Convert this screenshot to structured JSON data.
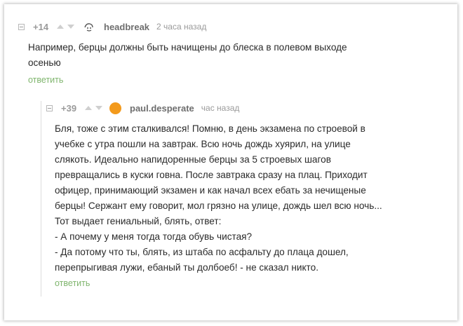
{
  "comments": [
    {
      "rating": "+14",
      "username": "headbreak",
      "time": "2 часа назад",
      "lines": [
        "Например, берцы должны быть начищены до блеска в полевом выходе",
        "осенью"
      ],
      "reply_label": "ответить"
    },
    {
      "rating": "+39",
      "username": "paul.desperate",
      "time": "час назад",
      "avatar_color": "#f39a1c",
      "lines": [
        "Бля, тоже с этим сталкивался! Помню, в день экзамена по строевой в",
        "учебке с утра пошли на завтрак. Всю ночь дождь хуярил, на улице",
        "слякоть. Идеально напидоренные берцы за 5 строевых шагов",
        "превращались в куски говна. После завтрака сразу на плац. Приходит",
        "офицер, принимающий экзамен и как начал всех ебать за нечищеные",
        "берцы! Сержант ему говорит, мол грязно на улице, дождь шел всю ночь...",
        "Тот выдает гениальный, блять, ответ:",
        "- А почему у меня тогда тогда обувь чистая?",
        "- Да потому что ты, блять, из штаба по асфальту до плаца дошел,",
        "перепрыгивая лужи, ебаный ты долбоеб! - не сказал никто."
      ],
      "reply_label": "ответить"
    }
  ],
  "icons": {
    "collapse": "collapse-toggle-icon",
    "upvote": "upvote-arrow-icon",
    "downvote": "downvote-arrow-icon",
    "avatar_default": "default-face-icon"
  }
}
